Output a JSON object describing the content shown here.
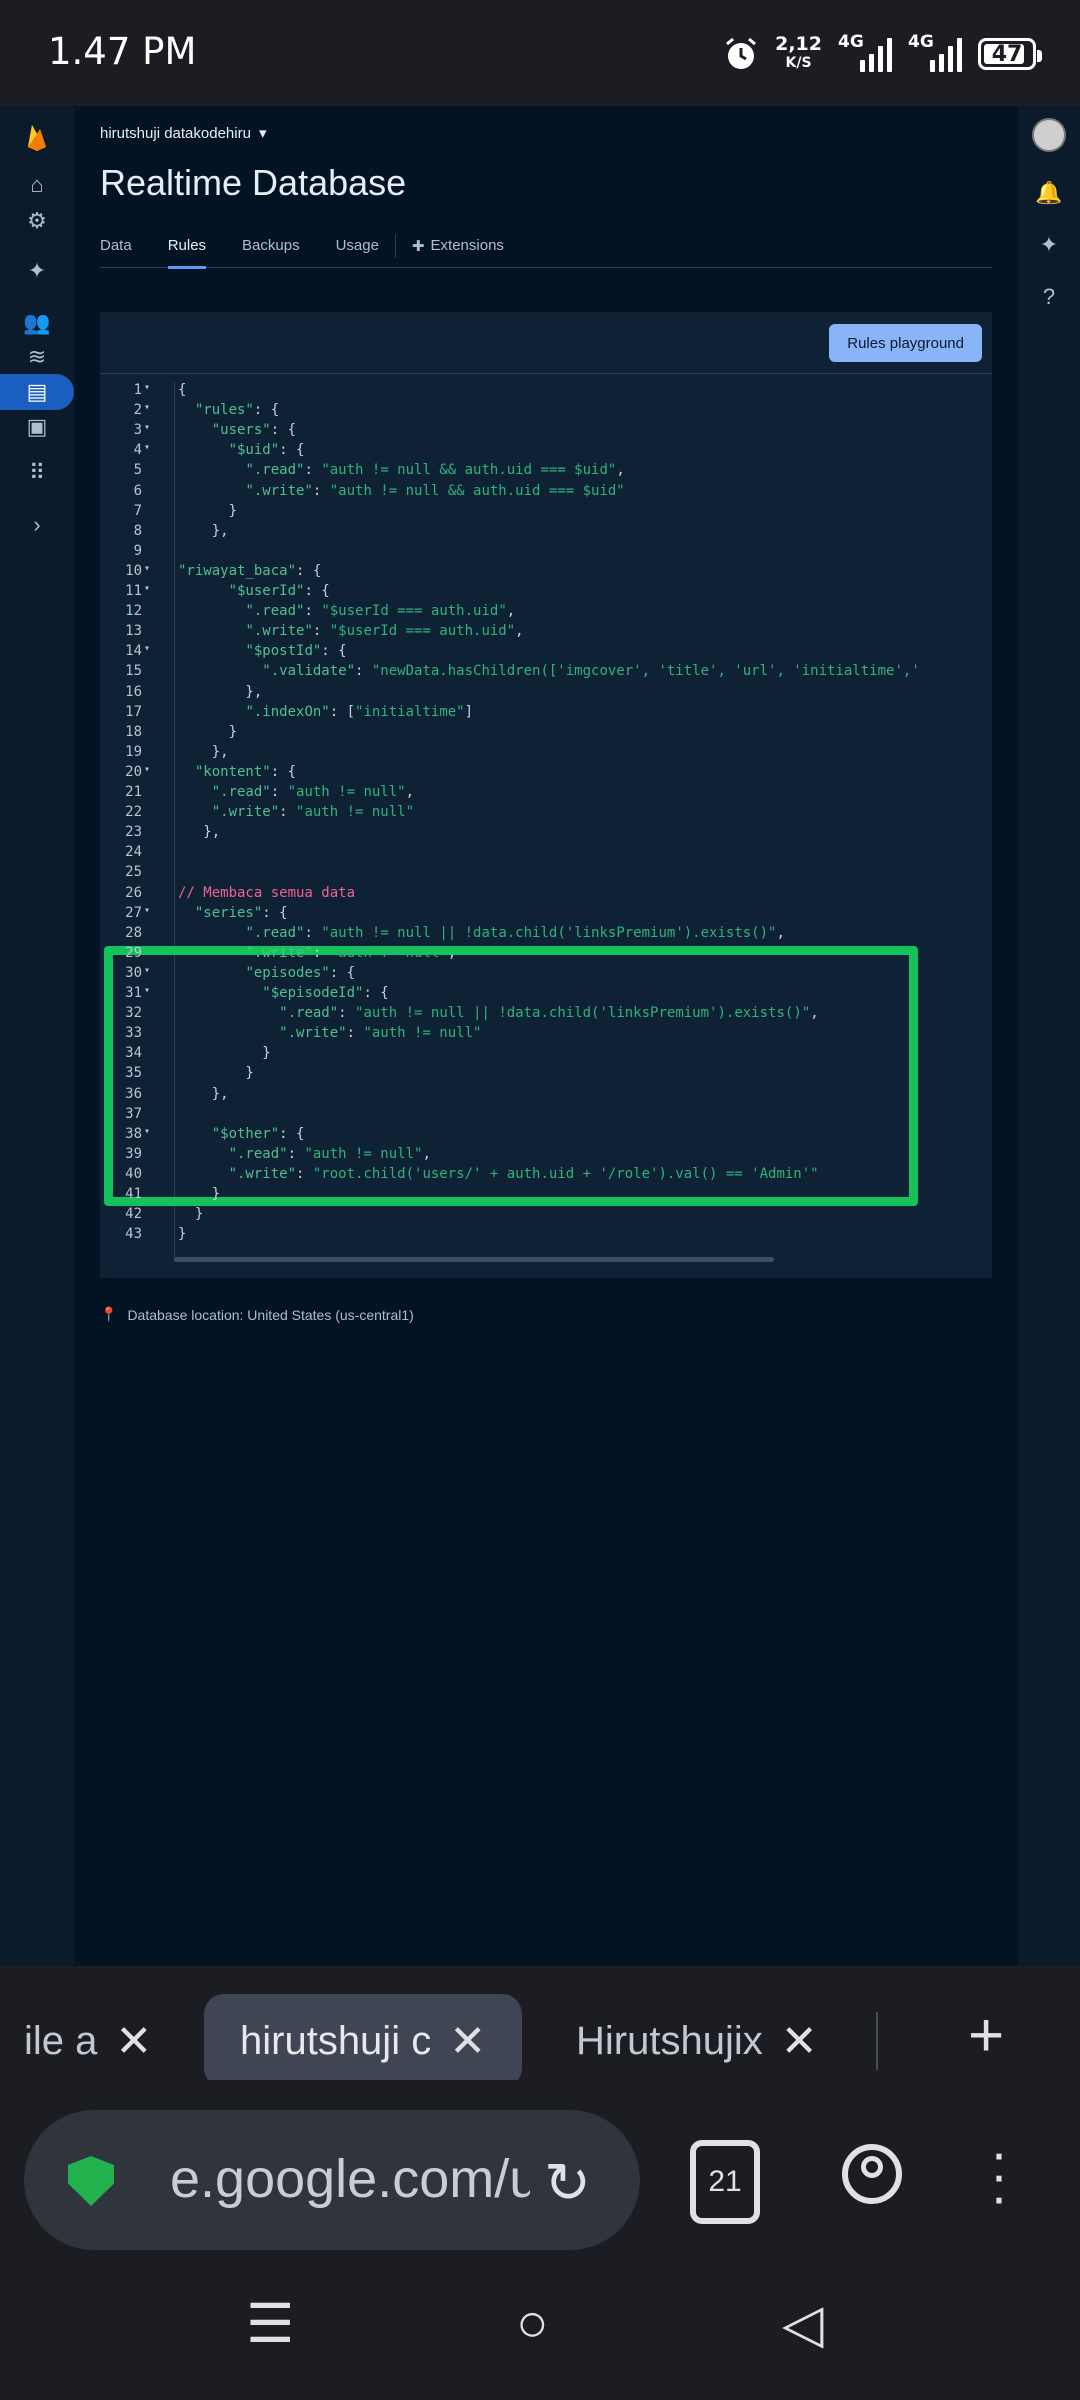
{
  "status_bar": {
    "time": "1.47 PM",
    "net_speed": "2,12",
    "net_unit": "K/S",
    "signal1": "4G",
    "signal2": "4G",
    "battery": "47"
  },
  "console": {
    "project_name": "hirutshuji datakodehiru",
    "page_title": "Realtime Database",
    "tabs": [
      {
        "label": "Data",
        "active": false
      },
      {
        "label": "Rules",
        "active": true
      },
      {
        "label": "Backups",
        "active": false
      },
      {
        "label": "Usage",
        "active": false
      },
      {
        "label": "Extensions",
        "active": false
      }
    ],
    "playground_button": "Rules playground",
    "database_location": "Database location: United States (us-central1)"
  },
  "code_lines": [
    "{",
    "  \"rules\": {",
    "    \"users\": {",
    "      \"$uid\": {",
    "        \".read\": \"auth != null && auth.uid === $uid\",",
    "        \".write\": \"auth != null && auth.uid === $uid\"",
    "      }",
    "    },",
    "",
    "\"riwayat_baca\": {",
    "      \"$userId\": {",
    "        \".read\": \"$userId === auth.uid\",",
    "        \".write\": \"$userId === auth.uid\",",
    "        \"$postId\": {",
    "          \".validate\": \"newData.hasChildren(['imgcover', 'title', 'url', 'initialtime','",
    "        },",
    "        \".indexOn\": [\"initialtime\"]",
    "      }",
    "    },",
    "  \"kontent\": {",
    "    \".read\": \"auth != null\",",
    "    \".write\": \"auth != null\"",
    "   },",
    "",
    "",
    "// Membaca semua data",
    "  \"series\": {",
    "        \".read\": \"auth != null || !data.child('linksPremium').exists()\",",
    "        \".write\": \"auth != null\",",
    "        \"episodes\": {",
    "          \"$episodeId\": {",
    "            \".read\": \"auth != null || !data.child('linksPremium').exists()\",",
    "            \".write\": \"auth != null\"",
    "          }",
    "        }",
    "    },",
    "",
    "    \"$other\": {",
    "      \".read\": \"auth != null\",",
    "      \".write\": \"root.child('users/' + auth.uid + '/role').val() == 'Admin'\"",
    "    }",
    "  }",
    "}"
  ],
  "browser": {
    "tabs": [
      {
        "title": "ile a",
        "active": false
      },
      {
        "title": "hirutshuji c",
        "active": true
      },
      {
        "title": "Hirutshujix",
        "active": false
      }
    ],
    "url": "e.google.com/u",
    "tab_count": "21"
  },
  "colors": {
    "highlight": "#12c25a",
    "accent": "#5a9bf6",
    "button": "#8ab4f8"
  }
}
